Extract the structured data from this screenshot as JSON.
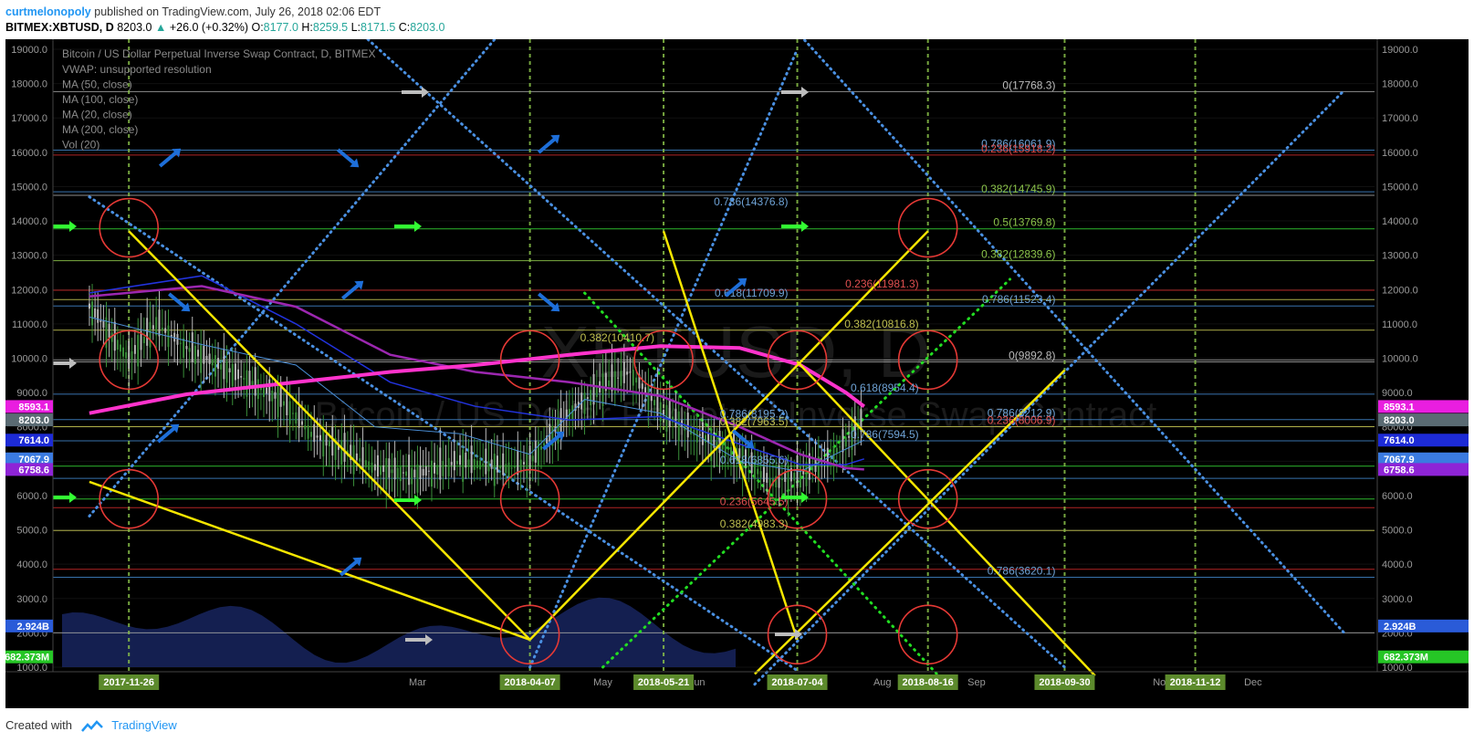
{
  "header": {
    "author": "curtmelonopoly",
    "published": " published on TradingView.com, July 26, 2018 02:06 EDT"
  },
  "ohlc": {
    "symbol": "BITMEX:XBTUSD, D",
    "last": "8203.0",
    "change": "+26.0 (+0.32%)",
    "o_label": "O:",
    "o": "8177.0",
    "h_label": "H:",
    "h": "8259.5",
    "l_label": "L:",
    "l": "8171.5",
    "c_label": "C:",
    "c": "8203.0"
  },
  "legend": {
    "title": "Bitcoin / US Dollar Perpetual Inverse Swap Contract, D, BITMEX",
    "lines": [
      "VWAP: unsupported resolution",
      "MA (50, close)",
      "MA (100, close)",
      "MA (20, close)",
      "MA (200, close)",
      "Vol (20)"
    ]
  },
  "watermark": {
    "ticker": "XBTUSD, D",
    "name": "Bitcoin / US Dollar Perpetual Inverse Swap Contract"
  },
  "footer": {
    "created": "Created with",
    "brand": "TradingView"
  },
  "colors": {
    "background": "#000000",
    "yellow": "#f5e600",
    "blue_dotted": "#4a90e2",
    "green_dashed": "#8bc34a",
    "red_circle": "#e53935",
    "magenta_ma": "#ff33cc",
    "purple_ma": "#9c27b0",
    "green_arrow": "#33ff33",
    "grey_arrow": "#bdbdbd",
    "blue_arrow": "#1e6fd9"
  },
  "chart_data": {
    "type": "line",
    "title": "Bitcoin / US Dollar Perpetual Inverse Swap Contract, D, BITMEX",
    "ylim": [
      1000,
      19000
    ],
    "y_ticks": [
      "19000.0",
      "18000.0",
      "17000.0",
      "16000.0",
      "15000.0",
      "14000.0",
      "13000.0",
      "12000.0",
      "11000.0",
      "10000.0",
      "9000.0",
      "8000.0",
      "7000.0",
      "6000.0",
      "5000.0",
      "4000.0",
      "3000.0",
      "2000.0",
      "1000.0"
    ],
    "months": [
      {
        "label": "Mar",
        "x": "2018-03-01"
      },
      {
        "label": "May",
        "x": "2018-05-01"
      },
      {
        "label": "Jun",
        "x": "2018-06-01"
      },
      {
        "label": "Aug",
        "x": "2018-08-01"
      },
      {
        "label": "Sep",
        "x": "2018-09-01"
      },
      {
        "label": "Nov",
        "x": "2018-11-01"
      },
      {
        "label": "Dec",
        "x": "2018-12-01"
      }
    ],
    "cycle_dates": [
      "2017-11-26",
      "2018-04-07",
      "2018-05-21",
      "2018-07-04",
      "2018-08-16",
      "2018-09-30",
      "2018-11-12"
    ],
    "price_tags": [
      {
        "label": "8593.1",
        "y": 8593.1,
        "color": "#e91ee0"
      },
      {
        "label": "8203.0",
        "y": 8203.0,
        "color": "#5a6b73"
      },
      {
        "label": "7614.0",
        "y": 7614.0,
        "color": "#1d2bd6"
      },
      {
        "label": "7067.9",
        "y": 7067.9,
        "color": "#3b7be0"
      },
      {
        "label": "6758.6",
        "y": 6758.6,
        "color": "#8e24d6"
      },
      {
        "label": "2.924B",
        "y": 2200,
        "color": "#2a5bd8"
      },
      {
        "label": "682.373M",
        "y": 1300,
        "color": "#26c626"
      }
    ],
    "fib_labels": [
      {
        "x": "2018-07-04",
        "y": 14376.8,
        "text": "0.786(14376.8)",
        "color": "#6fa3d6"
      },
      {
        "x": "2018-07-04",
        "y": 11709.9,
        "text": "0.618(11709.9)",
        "color": "#6fa3d6"
      },
      {
        "x": "2018-05-21",
        "y": 10410.7,
        "text": "0.382(10410.7)",
        "color": "#c0c050"
      },
      {
        "x": "2018-07-04",
        "y": 7963.5,
        "text": "0.382(7963.5)",
        "color": "#c0c050"
      },
      {
        "x": "2018-07-04",
        "y": 8195.2,
        "text": "0.786(8195.2)",
        "color": "#6fa3d6"
      },
      {
        "x": "2018-07-04",
        "y": 6855.6,
        "text": "0.618(6855.6)",
        "color": "#6fa3d6"
      },
      {
        "x": "2018-07-04",
        "y": 5645.5,
        "text": "0.236(5645.5)",
        "color": "#e05050"
      },
      {
        "x": "2018-07-04",
        "y": 4983.3,
        "text": "0.382(4983.3)",
        "color": "#c0c050"
      },
      {
        "x": "2018-08-16",
        "y": 11981.3,
        "text": "0.236(11981.3)",
        "color": "#e05050"
      },
      {
        "x": "2018-08-16",
        "y": 10816.8,
        "text": "0.382(10816.8)",
        "color": "#c0c050"
      },
      {
        "x": "2018-08-16",
        "y": 8954.4,
        "text": "0.618(8954.4)",
        "color": "#6fa3d6"
      },
      {
        "x": "2018-08-16",
        "y": 7594.5,
        "text": "0.786(7594.5)",
        "color": "#6fa3d6"
      },
      {
        "x": "2018-09-30",
        "y": 16061.9,
        "text": "0.786(16061.9)",
        "color": "#6fa3d6"
      },
      {
        "x": "2018-09-30",
        "y": 15918.2,
        "text": "0.236(15918.2)",
        "color": "#e05050"
      },
      {
        "x": "2018-09-30",
        "y": 14745.9,
        "text": "0.382(14745.9)",
        "color": "#8bc34a"
      },
      {
        "x": "2018-09-30",
        "y": 13769.8,
        "text": "0.5(13769.8)",
        "color": "#8bc34a"
      },
      {
        "x": "2018-09-30",
        "y": 12839.6,
        "text": "0.382(12839.6)",
        "color": "#8bc34a"
      },
      {
        "x": "2018-09-30",
        "y": 11523.4,
        "text": "0.786(11523.4)",
        "color": "#6fa3d6"
      },
      {
        "x": "2018-09-30",
        "y": 8212.9,
        "text": "0.786(8212.9)",
        "color": "#6fa3d6"
      },
      {
        "x": "2018-09-30",
        "y": 8006.9,
        "text": "0.236(8006.9)",
        "color": "#e05050"
      },
      {
        "x": "2018-09-30",
        "y": 3620.1,
        "text": "0.786(3620.1)",
        "color": "#6fa3d6"
      },
      {
        "x": "2018-09-30",
        "y": 17768.3,
        "text": "0(17768.3)",
        "color": "#bdbdbd"
      },
      {
        "x": "2018-09-30",
        "y": 9892.8,
        "text": "0(9892.8)",
        "color": "#bdbdbd"
      }
    ],
    "h_levels": [
      {
        "y": 17768,
        "color": "#9e9e9e"
      },
      {
        "y": 16061,
        "color": "#3f7fbf"
      },
      {
        "y": 15918,
        "color": "#c62828"
      },
      {
        "y": 14850,
        "color": "#3f7fbf"
      },
      {
        "y": 14746,
        "color": "#9e9e9e"
      },
      {
        "y": 13770,
        "color": "#33cc33"
      },
      {
        "y": 12840,
        "color": "#8bc34a"
      },
      {
        "y": 11981,
        "color": "#c62828"
      },
      {
        "y": 11709,
        "color": "#c0c050"
      },
      {
        "y": 11523,
        "color": "#3f7fbf"
      },
      {
        "y": 10816,
        "color": "#c0c050"
      },
      {
        "y": 9950,
        "color": "#9e9e9e"
      },
      {
        "y": 9893,
        "color": "#9e9e9e"
      },
      {
        "y": 8954,
        "color": "#3f7fbf"
      },
      {
        "y": 8213,
        "color": "#3f7fbf"
      },
      {
        "y": 8007,
        "color": "#c0c050"
      },
      {
        "y": 7594,
        "color": "#3f7fbf"
      },
      {
        "y": 6855,
        "color": "#33cc33"
      },
      {
        "y": 6500,
        "color": "#3f7fbf"
      },
      {
        "y": 5900,
        "color": "#33cc33"
      },
      {
        "y": 5645,
        "color": "#c62828"
      },
      {
        "y": 4983,
        "color": "#c0c050"
      },
      {
        "y": 3850,
        "color": "#c62828"
      },
      {
        "y": 3620,
        "color": "#3f7fbf"
      },
      {
        "y": 2000,
        "color": "#9e9e9e"
      }
    ],
    "yellow_lines": [
      {
        "from": [
          "2017-11-26",
          13700
        ],
        "to": [
          "2018-04-07",
          1800
        ]
      },
      {
        "from": [
          "2017-11-13",
          6400
        ],
        "to": [
          "2018-04-07",
          1800
        ]
      },
      {
        "from": [
          "2018-04-07",
          1800
        ],
        "to": [
          "2018-08-16",
          13700
        ]
      },
      {
        "from": [
          "2018-05-21",
          13700
        ],
        "to": [
          "2018-07-04",
          1800
        ]
      },
      {
        "from": [
          "2018-06-20",
          800
        ],
        "to": [
          "2018-09-30",
          9650
        ]
      },
      {
        "from": [
          "2018-07-04",
          9900
        ],
        "to": [
          "2018-10-10",
          750
        ]
      }
    ],
    "blue_dotted_lines": [
      {
        "from": [
          "2017-11-13",
          14700
        ],
        "to": [
          "2018-07-04",
          900
        ]
      },
      {
        "from": [
          "2017-11-13",
          5400
        ],
        "to": [
          "2018-04-07",
          20500
        ]
      },
      {
        "from": [
          "2018-02-10",
          19500
        ],
        "to": [
          "2018-09-30",
          1000
        ]
      },
      {
        "from": [
          "2018-04-07",
          1000
        ],
        "to": [
          "2018-07-04",
          19000
        ]
      },
      {
        "from": [
          "2018-06-20",
          500
        ],
        "to": [
          "2018-12-31",
          17800
        ]
      },
      {
        "from": [
          "2018-07-04",
          19500
        ],
        "to": [
          "2018-12-31",
          2000
        ]
      }
    ],
    "green_dotted_lines": [
      {
        "from": [
          "2018-04-25",
          11900
        ],
        "to": [
          "2018-08-20",
          700
        ]
      },
      {
        "from": [
          "2018-05-01",
          1000
        ],
        "to": [
          "2018-09-12",
          12300
        ]
      }
    ],
    "red_circles": [
      {
        "x": "2017-11-26",
        "y": 13800
      },
      {
        "x": "2017-11-26",
        "y": 9950
      },
      {
        "x": "2017-11-26",
        "y": 5900
      },
      {
        "x": "2018-04-07",
        "y": 9950
      },
      {
        "x": "2018-04-07",
        "y": 5900
      },
      {
        "x": "2018-04-07",
        "y": 1950
      },
      {
        "x": "2018-05-21",
        "y": 9950
      },
      {
        "x": "2018-07-04",
        "y": 9950
      },
      {
        "x": "2018-07-04",
        "y": 5900
      },
      {
        "x": "2018-07-04",
        "y": 1950
      },
      {
        "x": "2018-08-16",
        "y": 13800
      },
      {
        "x": "2018-08-16",
        "y": 9950
      },
      {
        "x": "2018-08-16",
        "y": 5900
      },
      {
        "x": "2018-08-16",
        "y": 1950
      }
    ],
    "ma200": [
      [
        "2017-11-13",
        8400
      ],
      [
        "2017-12-15",
        8950
      ],
      [
        "2018-01-20",
        9300
      ],
      [
        "2018-02-20",
        9600
      ],
      [
        "2018-03-20",
        9800
      ],
      [
        "2018-04-20",
        10100
      ],
      [
        "2018-05-20",
        10350
      ],
      [
        "2018-06-15",
        10300
      ],
      [
        "2018-07-05",
        9800
      ],
      [
        "2018-07-20",
        9000
      ],
      [
        "2018-07-26",
        8593
      ]
    ],
    "ma100": [
      [
        "2017-11-13",
        11800
      ],
      [
        "2017-12-20",
        12100
      ],
      [
        "2018-01-20",
        11500
      ],
      [
        "2018-02-20",
        10100
      ],
      [
        "2018-03-20",
        9600
      ],
      [
        "2018-04-20",
        9300
      ],
      [
        "2018-05-20",
        8900
      ],
      [
        "2018-06-15",
        8000
      ],
      [
        "2018-07-05",
        7200
      ],
      [
        "2018-07-20",
        6800
      ],
      [
        "2018-07-26",
        6758
      ]
    ],
    "ma50": [
      [
        "2017-11-13",
        11900
      ],
      [
        "2017-12-20",
        12400
      ],
      [
        "2018-01-20",
        11000
      ],
      [
        "2018-02-20",
        9300
      ],
      [
        "2018-03-20",
        8600
      ],
      [
        "2018-04-20",
        8200
      ],
      [
        "2018-05-20",
        8300
      ],
      [
        "2018-06-15",
        7500
      ],
      [
        "2018-07-05",
        6900
      ],
      [
        "2018-07-20",
        6900
      ],
      [
        "2018-07-26",
        7067
      ]
    ],
    "ma20": [
      [
        "2017-11-13",
        11200
      ],
      [
        "2017-12-20",
        10400
      ],
      [
        "2018-01-20",
        9800
      ],
      [
        "2018-02-15",
        8000
      ],
      [
        "2018-03-15",
        7800
      ],
      [
        "2018-04-07",
        7200
      ],
      [
        "2018-04-25",
        8800
      ],
      [
        "2018-05-20",
        8400
      ],
      [
        "2018-06-15",
        7000
      ],
      [
        "2018-07-05",
        6700
      ],
      [
        "2018-07-26",
        7614
      ]
    ],
    "price_path": [
      [
        "2017-11-13",
        11500
      ],
      [
        "2017-11-26",
        10000
      ],
      [
        "2017-12-05",
        11000
      ],
      [
        "2017-12-15",
        10300
      ],
      [
        "2018-01-01",
        9500
      ],
      [
        "2018-01-15",
        8800
      ],
      [
        "2018-01-25",
        7800
      ],
      [
        "2018-02-05",
        7300
      ],
      [
        "2018-02-15",
        6800
      ],
      [
        "2018-03-01",
        6600
      ],
      [
        "2018-03-15",
        7000
      ],
      [
        "2018-04-01",
        6800
      ],
      [
        "2018-04-07",
        7000
      ],
      [
        "2018-04-20",
        8400
      ],
      [
        "2018-05-01",
        9200
      ],
      [
        "2018-05-10",
        9600
      ],
      [
        "2018-05-21",
        8400
      ],
      [
        "2018-06-01",
        7800
      ],
      [
        "2018-06-15",
        7200
      ],
      [
        "2018-06-25",
        6400
      ],
      [
        "2018-07-04",
        6600
      ],
      [
        "2018-07-12",
        6900
      ],
      [
        "2018-07-20",
        7600
      ],
      [
        "2018-07-26",
        8203
      ]
    ]
  }
}
